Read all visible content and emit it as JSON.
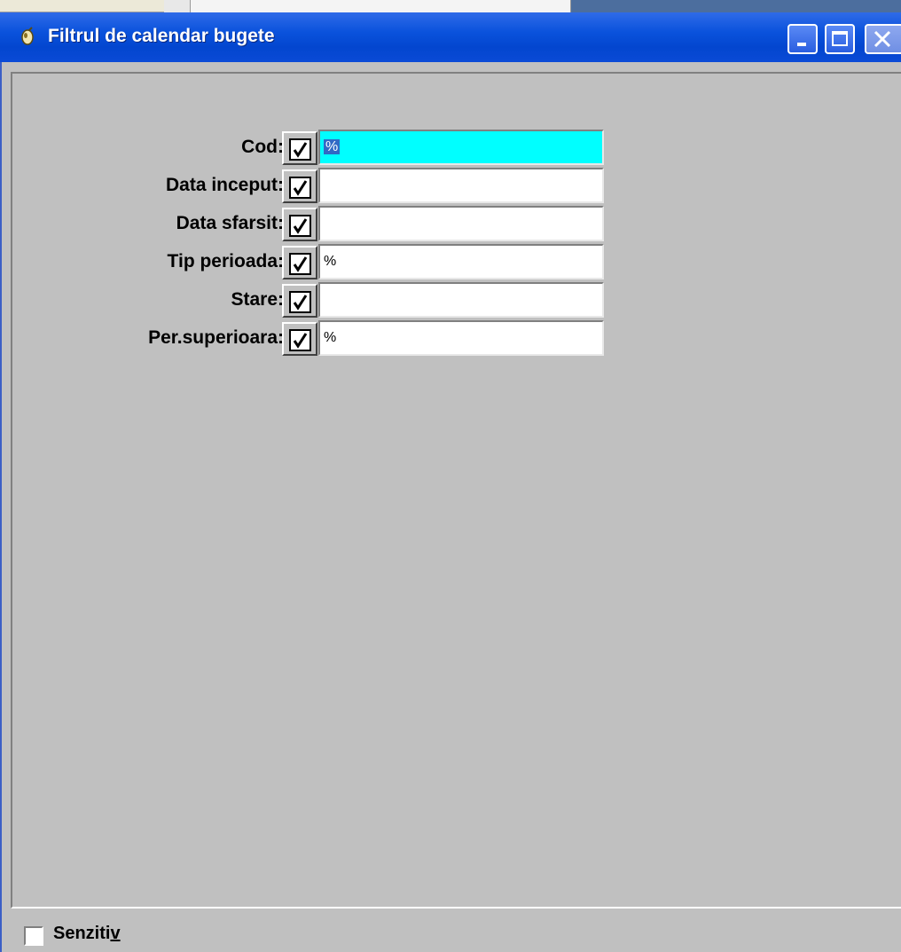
{
  "window": {
    "title": "Filtrul de calendar bugete"
  },
  "filters": [
    {
      "label": "Cod:",
      "checked": true,
      "value": "%",
      "active": true
    },
    {
      "label": "Data inceput:",
      "checked": true,
      "value": ""
    },
    {
      "label": "Data sfarsit:",
      "checked": true,
      "value": ""
    },
    {
      "label": "Tip perioada:",
      "checked": true,
      "value": "%"
    },
    {
      "label": "Stare:",
      "checked": true,
      "value": ""
    },
    {
      "label": "Per.superioara:",
      "checked": true,
      "value": "%"
    }
  ],
  "footer": {
    "sensitive_label_main": "Senziti",
    "sensitive_label_mnemonic": "v",
    "sensitive_checked": false
  },
  "colors": {
    "titlebar": "#0a52dc",
    "active_field": "#00ffff",
    "selection": "#316ac5",
    "panel": "#c0c0c0"
  },
  "icons": {
    "title": "app-icon",
    "minimize": "minimize-icon",
    "maximize": "maximize-icon",
    "close": "close-icon",
    "check": "checkmark-icon"
  }
}
